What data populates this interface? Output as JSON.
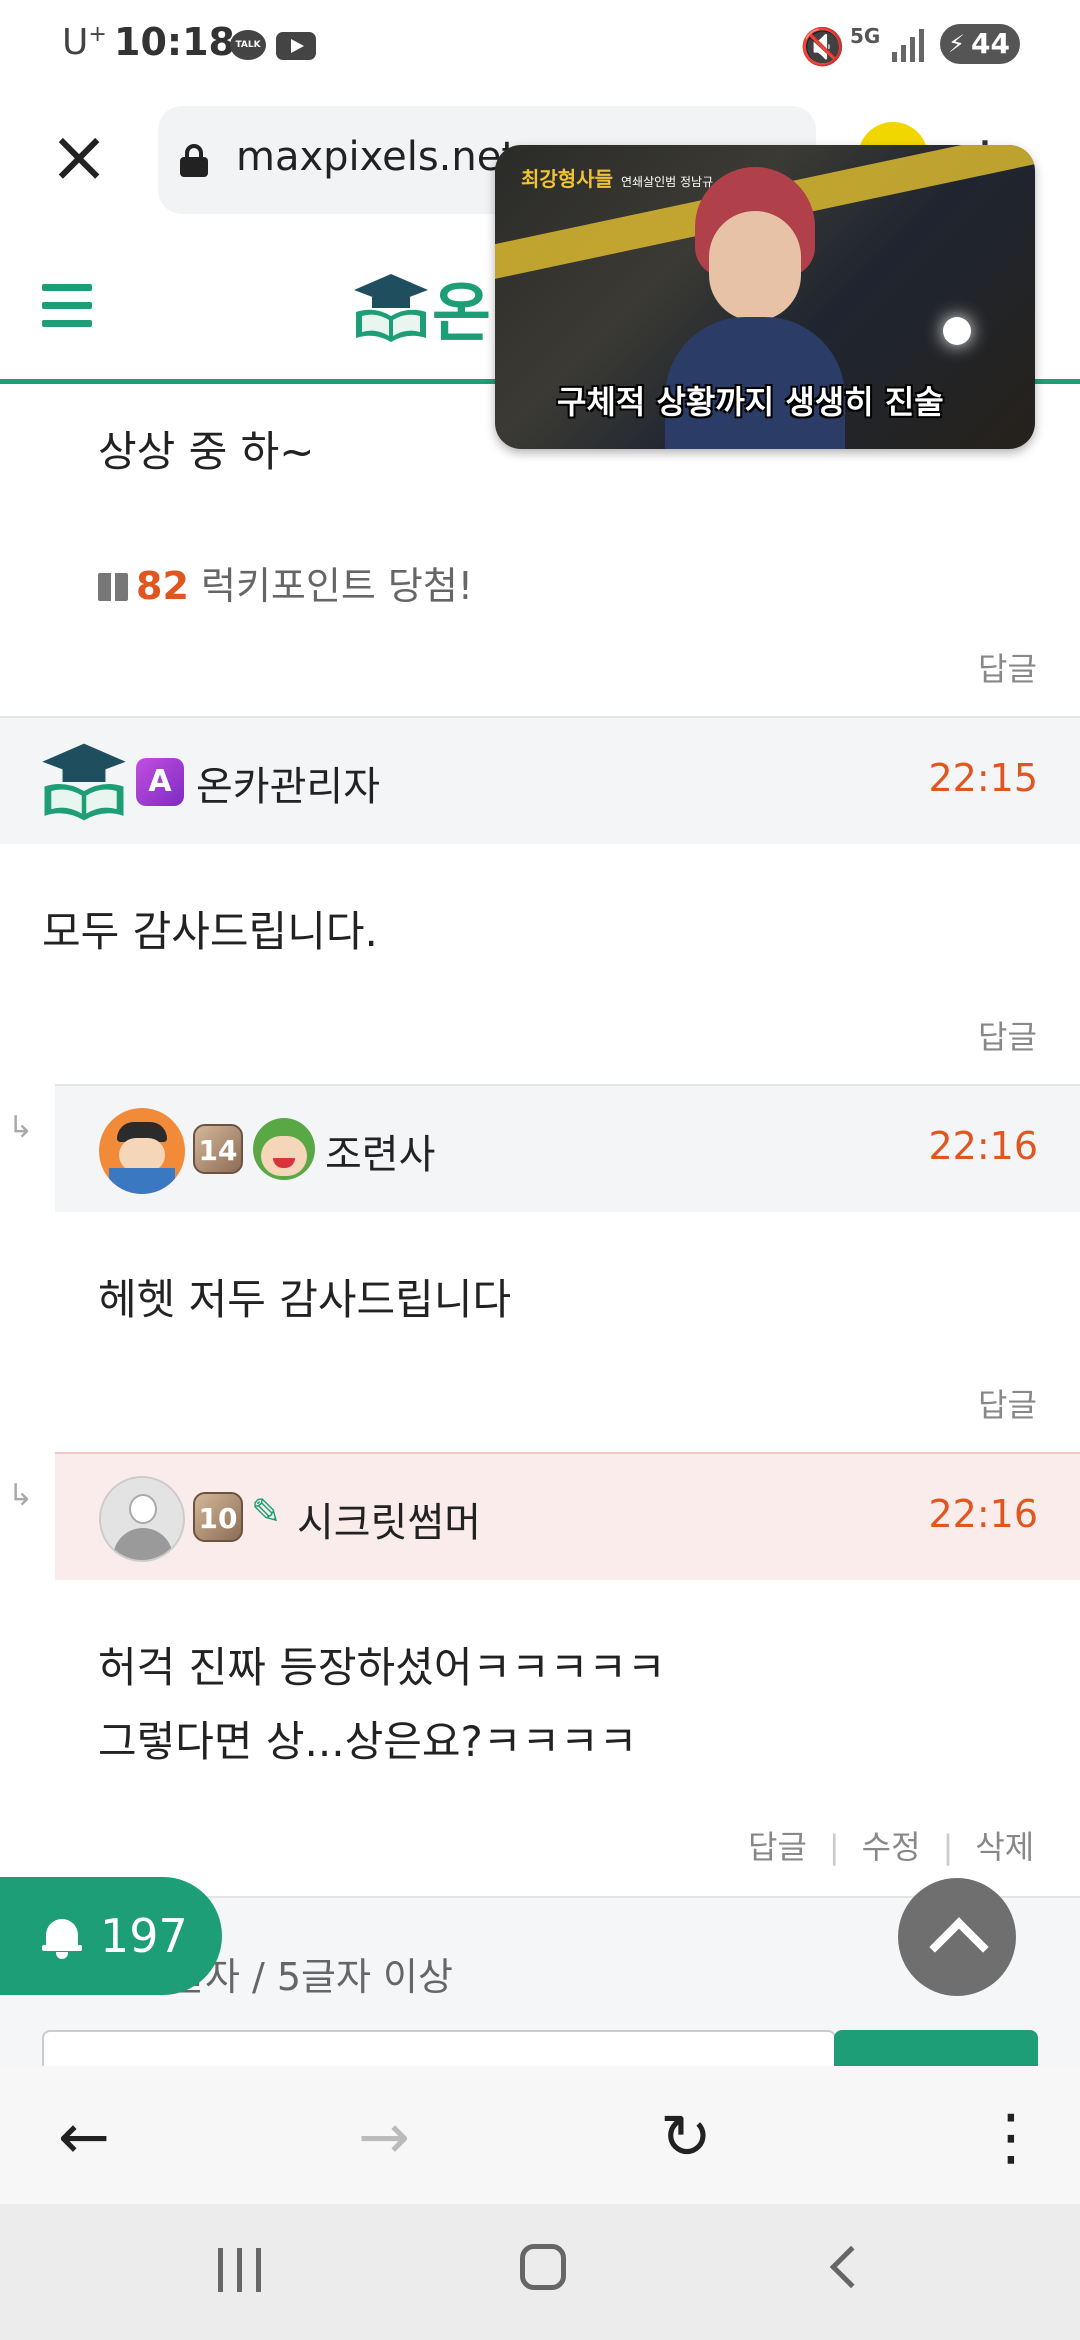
{
  "status_bar": {
    "carrier": "U",
    "carrier_sup": "+",
    "time": "10:18",
    "talk_label": "TALK",
    "network": "5G",
    "battery": "44"
  },
  "browser": {
    "url": "maxpixels.net"
  },
  "site": {
    "logo_text": "온"
  },
  "pip": {
    "top_caption": "최강형사들",
    "top_caption_small": "연쇄살인범 정남규",
    "subtitle": "구체적 상황까지 생생히 진술"
  },
  "comments": {
    "prev_text": "상상 중 하~",
    "lucky_points": "82",
    "lucky_label": "럭키포인트 당첨!",
    "reply_label": "답글",
    "c1": {
      "badge": "A",
      "nickname": "온카관리자",
      "time": "22:15",
      "text": "모두 감사드립니다."
    },
    "c2": {
      "level": "14",
      "nickname": "조련사",
      "time": "22:16",
      "text": "헤헷 저두 감사드립니다"
    },
    "c3": {
      "level": "10",
      "nickname": "시크릿썸머",
      "time": "22:16",
      "line1": "허걱 진짜 등장하셨어ㅋㅋㅋㅋㅋ",
      "line2": "그렇다면 상...상은요?ㅋㅋㅋㅋ",
      "reply_label": "답글",
      "edit_label": "수정",
      "delete_label": "삭제"
    }
  },
  "form": {
    "char_count": "글자 / 5글자 이상"
  },
  "notification": {
    "count": "197"
  },
  "colors": {
    "accent": "#1e9e76",
    "time": "#e0561e",
    "lucky_number": "#e0561e"
  }
}
